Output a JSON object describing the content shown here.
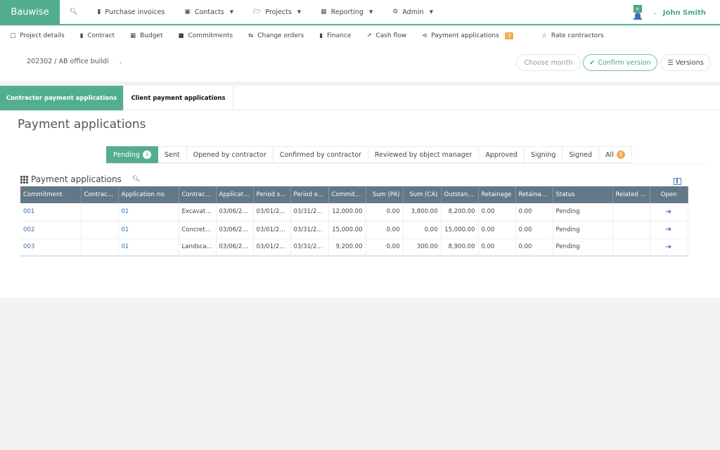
{
  "app": {
    "brand": "Bauwise",
    "notification_count": "6",
    "user_name": "John Smith"
  },
  "topnav": [
    {
      "label": "Purchase invoices",
      "icon": "book-icon"
    },
    {
      "label": "Contacts",
      "icon": "contact-icon"
    },
    {
      "label": "Projects",
      "icon": "folder-icon"
    },
    {
      "label": "Reporting",
      "icon": "bar-chart-icon"
    },
    {
      "label": "Admin",
      "icon": "gear-icon"
    }
  ],
  "subnav": [
    {
      "label": "Project details"
    },
    {
      "label": "Contract"
    },
    {
      "label": "Budget"
    },
    {
      "label": "Commitments"
    },
    {
      "label": "Change orders"
    },
    {
      "label": "Finance"
    },
    {
      "label": "Cash flow"
    },
    {
      "label": "Payment applications",
      "badge": "3"
    },
    {
      "label": "Rate contractors"
    }
  ],
  "project": {
    "selected": "202302 / AB office buildi",
    "month_placeholder": "Choose month",
    "confirm_label": "Confirm version",
    "versions_label": "Versions"
  },
  "tabs": [
    {
      "label": "Contractor payment applications",
      "active": true
    },
    {
      "label": "Client payment applications",
      "active": false
    }
  ],
  "page_title": "Payment applications",
  "status_tabs": [
    {
      "label": "Pending",
      "count": "3",
      "active": true
    },
    {
      "label": "Sent"
    },
    {
      "label": "Opened by contractor"
    },
    {
      "label": "Confirmed by contractor"
    },
    {
      "label": "Reviewed by object manager"
    },
    {
      "label": "Approved"
    },
    {
      "label": "Signing"
    },
    {
      "label": "Signed"
    },
    {
      "label": "All",
      "count": "3"
    }
  ],
  "grid": {
    "title": "Payment applications",
    "columns": [
      "Commitment",
      "Contract ...",
      "Application no.",
      "Contractor",
      "Applicati...",
      "Period st...",
      "Period end",
      "Committ...",
      "Sum (PA)",
      "Sum (CA)",
      "Outstand...",
      "Retainage",
      "Retainag...",
      "Status",
      "Related i...",
      "Open"
    ],
    "rows": [
      [
        "001",
        "",
        "01",
        "Excavato...",
        "03/06/20...",
        "03/01/20...",
        "03/31/20...",
        "12,000.00",
        "0.00",
        "3,800.00",
        "8,200.00",
        "0.00",
        "0.00",
        "Pending",
        ""
      ],
      [
        "002",
        "",
        "01",
        "Concrete ...",
        "03/06/20...",
        "03/01/20...",
        "03/31/20...",
        "15,000.00",
        "0.00",
        "0.00",
        "15,000.00",
        "0.00",
        "0.00",
        "Pending",
        ""
      ],
      [
        "003",
        "",
        "01",
        "Landscap...",
        "03/06/20...",
        "03/01/20...",
        "03/31/20...",
        "9,200.00",
        "0.00",
        "300.00",
        "8,900.00",
        "0.00",
        "0.00",
        "Pending",
        ""
      ]
    ]
  }
}
